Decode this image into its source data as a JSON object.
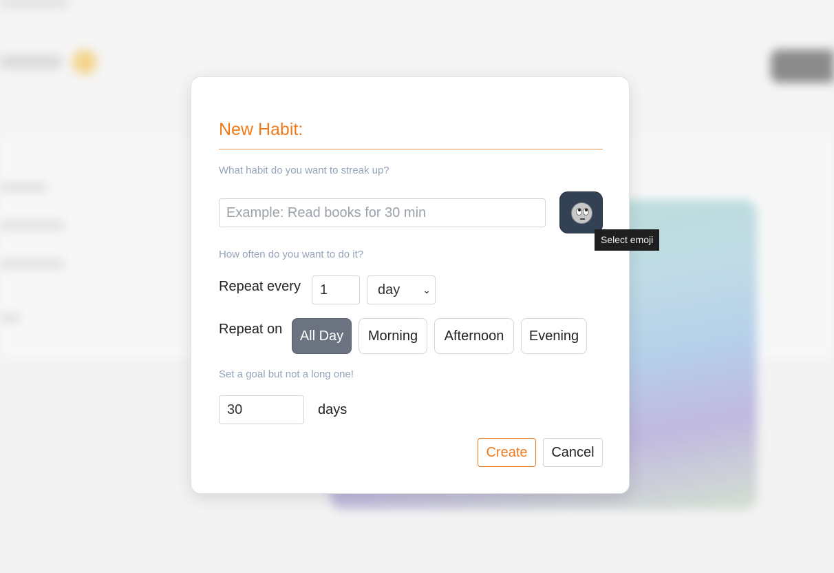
{
  "modal": {
    "title": "New Habit:",
    "habit_hint": "What habit do you want to streak up?",
    "habit_input": {
      "value": "",
      "placeholder": "Example: Read books for 30 min"
    },
    "emoji_tooltip": "Select emoji",
    "frequency_hint": "How often do you want to do it?",
    "repeat_every_label": "Repeat every",
    "repeat_every_value": "1",
    "repeat_unit": "day",
    "repeat_on_label": "Repeat on",
    "time_options": [
      {
        "label": "All Day",
        "selected": true
      },
      {
        "label": "Morning",
        "selected": false
      },
      {
        "label": "Afternoon",
        "selected": false
      },
      {
        "label": "Evening",
        "selected": false
      }
    ],
    "goal_hint": "Set a goal but not a long one!",
    "goal_value": "30",
    "goal_unit": "days",
    "create_label": "Create",
    "cancel_label": "Cancel"
  },
  "colors": {
    "accent": "#f07a1a",
    "emoji_button": "#334155",
    "chip_active": "#6b7280",
    "hint": "#94a3b8"
  },
  "icons": {
    "emoji": "face-with-rolling-eyes-icon",
    "dropdown": "chevron-down-icon"
  }
}
